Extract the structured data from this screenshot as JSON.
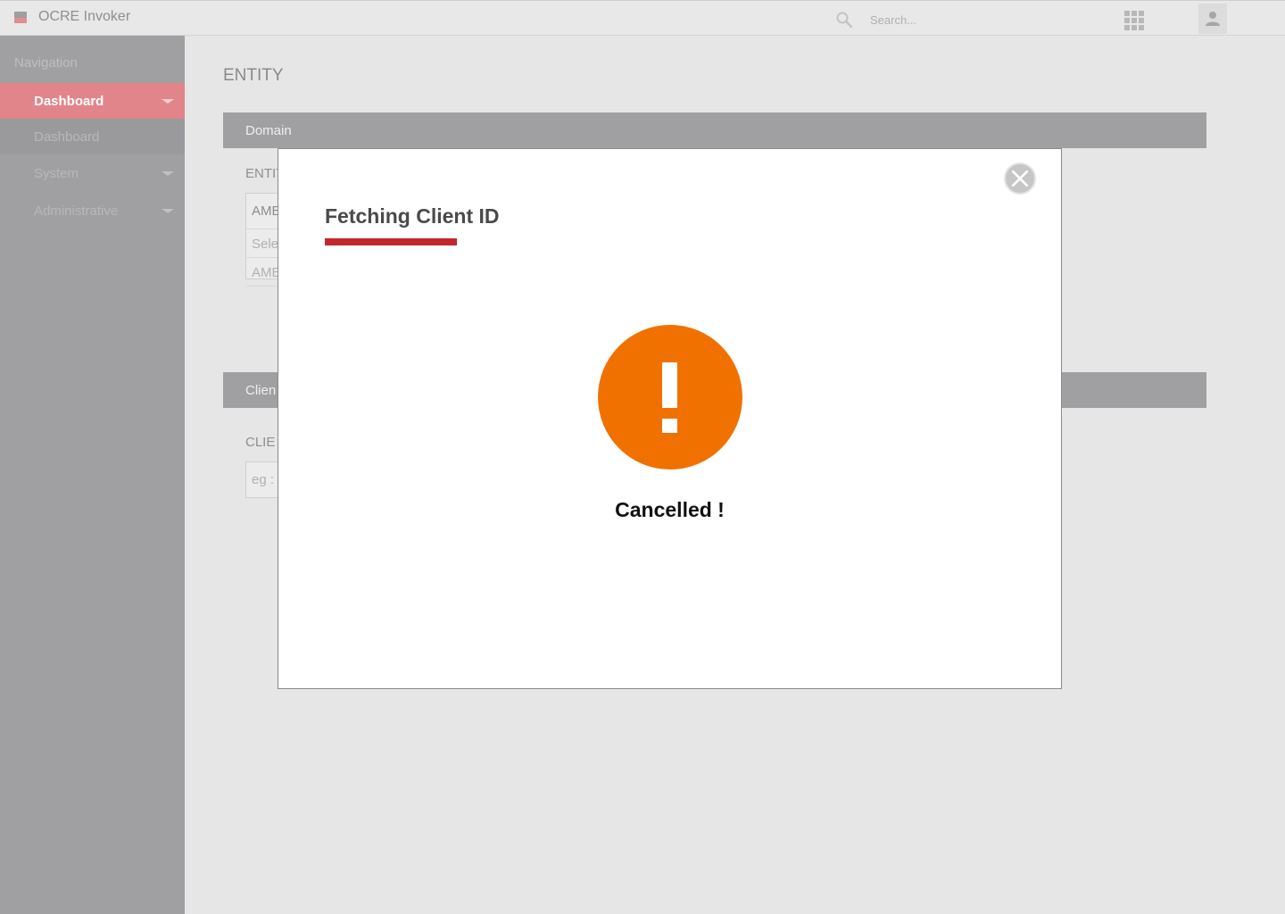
{
  "app": {
    "title": "OCRE Invoker"
  },
  "header": {
    "search_placeholder": "Search..."
  },
  "sidebar": {
    "heading": "Navigation",
    "items": [
      {
        "label": "Dashboard",
        "state": "active",
        "has_caret": true
      },
      {
        "label": "Dashboard",
        "state": "sub",
        "has_caret": false
      },
      {
        "label": "System",
        "state": "normal",
        "has_caret": true
      },
      {
        "label": "Administrative",
        "state": "normal",
        "has_caret": true
      }
    ]
  },
  "main": {
    "page_title": "ENTITY",
    "domain_panel": {
      "header": "Domain",
      "field_label": "ENTIT",
      "select_selected": "AME",
      "select_options": [
        "Sele",
        "AME"
      ]
    },
    "client_panel": {
      "header": "Clien",
      "field_label": "CLIE",
      "input_placeholder": "eg :"
    }
  },
  "modal": {
    "title": "Fetching Client ID",
    "status": "Cancelled !",
    "icon": "exclamation-icon",
    "accent_color": "#c1272d",
    "icon_color": "#f07100"
  },
  "colors": {
    "sidebar_active": "#e2858a",
    "sidebar_bg": "#a0a0a3",
    "panel_header": "#a09fa1"
  }
}
